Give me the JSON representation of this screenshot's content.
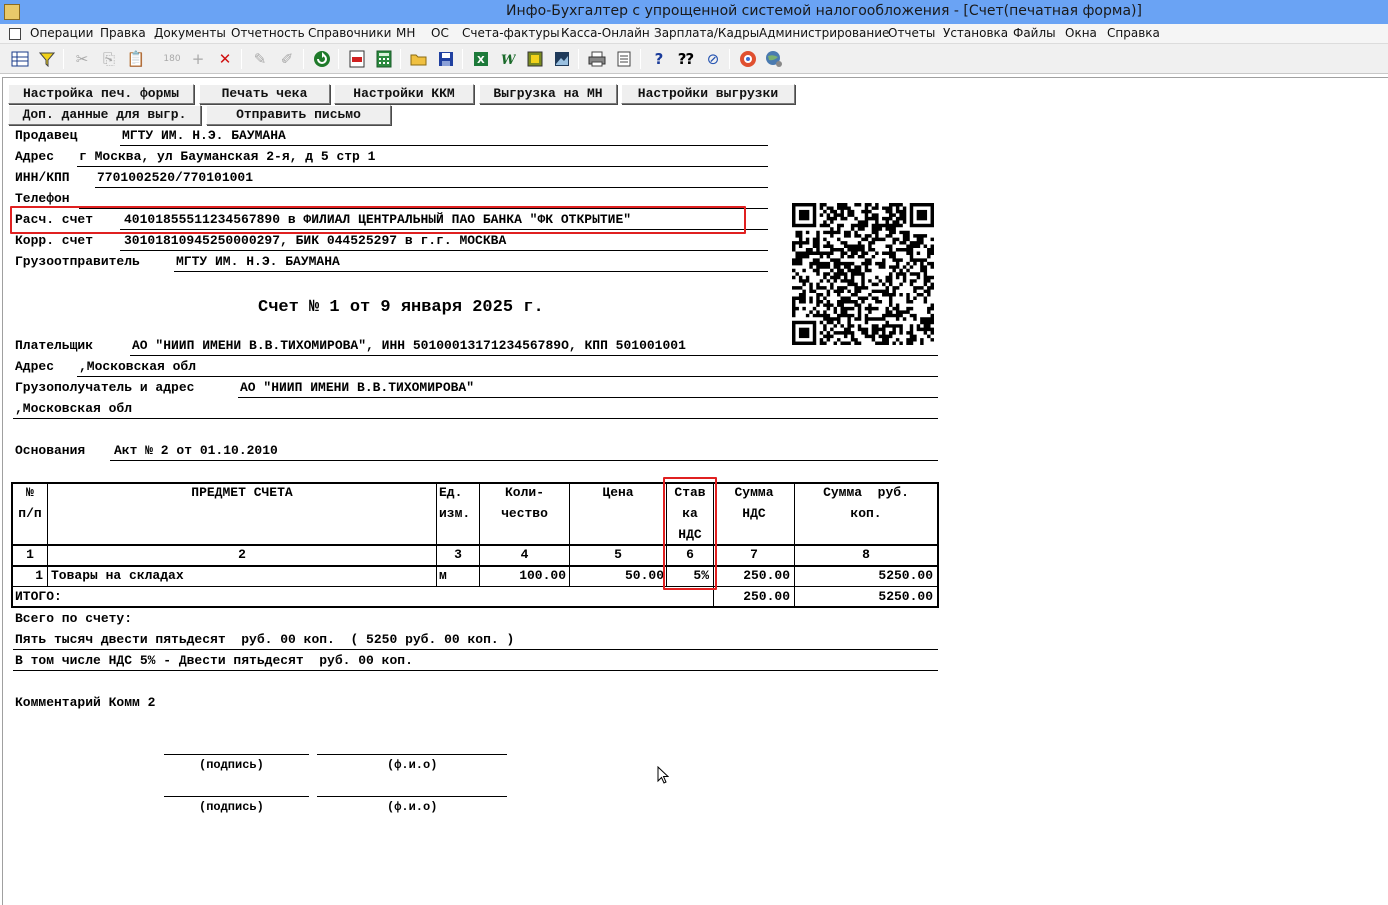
{
  "window": {
    "title": "Инфо-Бухгалтер с упрощенной системой налогообложения - [Счет(печатная форма)]"
  },
  "menu": [
    "Операции",
    "Правка",
    "Документы",
    "Отчетность",
    "Справочники",
    "МН",
    "ОС",
    "Счета-фактуры",
    "Касса-Онлайн",
    "Зарплата/Кадры",
    "Администрирование",
    "Отчеты",
    "Установка",
    "Файлы",
    "Окна",
    "Справка"
  ],
  "toolbar": {
    "icons": [
      "grid-icon",
      "filter-icon",
      "cut-icon",
      "copy-icon",
      "paste-icon",
      "rotate-icon",
      "add-icon",
      "delete-icon",
      "link-icon",
      "unlink-icon",
      "refresh-icon",
      "pdf-icon",
      "calculator-icon",
      "open-folder-icon",
      "save-icon",
      "excel-icon",
      "word-icon",
      "export-icon",
      "image-icon",
      "print-icon",
      "preview-icon",
      "help-icon",
      "context-help-icon",
      "compass-icon",
      "support-icon",
      "globe-icon"
    ]
  },
  "buttons": {
    "print_settings": "Настройка печ. формы",
    "print_check": "Печать чека",
    "kkm_settings": "Настройки ККМ",
    "export_mn": "Выгрузка на МН",
    "export_settings": "Настройки выгрузки",
    "extra_data": "Доп. данные для выгр.",
    "send_letter": "Отправить письмо"
  },
  "seller": {
    "name_label": "Продавец",
    "name": "МГТУ ИМ. Н.Э. БАУМАНА",
    "address_label": "Адрес",
    "address": "г Москва, ул Бауманская 2-я, д 5 стр 1",
    "inn_label": "ИНН/КПП",
    "inn": "7701002520/770101001",
    "phone_label": "Телефон",
    "phone": "",
    "account_label": "Расч. счет",
    "account": "40101855511234567890 в ФИЛИАЛ ЦЕНТРАЛЬНЫЙ ПАО БАНКА \"ФК ОТКРЫТИЕ\"",
    "corr_label": "Корр. счет",
    "corr": "30101810945250000297, БИК 044525297 в г.г. МОСКВА",
    "shipper_label": "Грузоотправитель",
    "shipper": "МГТУ ИМ. Н.Э. БАУМАНА"
  },
  "invoice_title": "Счет № 1 от 9 января 2025 г.",
  "payer": {
    "label": "Плательщик",
    "value": "АО \"НИИП ИМЕНИ В.В.ТИХОМИРОВА\", ИНН 5010001317123456789О, КПП 501001001",
    "address_label": "Адрес",
    "address": ",Московская обл",
    "consignee_label": "Грузополучатель и адрес",
    "consignee": "АО \"НИИП ИМЕНИ В.В.ТИХОМИРОВА\"",
    "consignee_address": ",Московская обл"
  },
  "basis": {
    "label": "Основания",
    "value": "Акт № 2 от 01.10.2010"
  },
  "table": {
    "headers": {
      "num_1": "№",
      "num_2": "п/п",
      "item": "ПРЕДМЕТ СЧЕТА",
      "unit_1": "Ед.",
      "unit_2": "изм.",
      "qty_1": "Коли-",
      "qty_2": "чество",
      "price": "Цена",
      "rate_1": "Став",
      "rate_2": "ка",
      "rate_3": "НДС",
      "vat_1": "Сумма",
      "vat_2": "НДС",
      "sum_1": "Сумма  руб.",
      "sum_2": "коп."
    },
    "col_numbers": [
      "1",
      "2",
      "3",
      "4",
      "5",
      "6",
      "7",
      "8"
    ],
    "rows": [
      {
        "num": "1",
        "item": "Товары на складах",
        "unit": "м",
        "qty": "100.00",
        "price": "50.00",
        "rate": "5%",
        "vat": "250.00",
        "sum": "5250.00"
      }
    ],
    "total_label": "ИТОГО:",
    "total_vat": "250.00",
    "total_sum": "5250.00"
  },
  "totals": {
    "label": "Всего по счету:",
    "in_words": "Пять тысяч двести пятьдесят  руб. 00 коп.  ( 5250 руб. 00 коп. )",
    "vat_words": "В том числе НДС 5% - Двести пятьдесят  руб. 00 коп."
  },
  "comment": "Комментарий Комм 2",
  "signatures": {
    "sign": "(подпись)",
    "fio": "(ф.и.о)"
  },
  "colors": {
    "titlebar": "#6aa3f4",
    "highlight": "#e02020"
  }
}
